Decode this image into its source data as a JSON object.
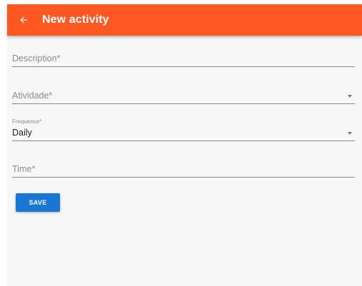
{
  "appbar": {
    "title": "New activity",
    "back_icon": "arrow-left-icon",
    "background": "#ff5722"
  },
  "form": {
    "description": {
      "placeholder": "Description*",
      "value": ""
    },
    "atividade": {
      "placeholder": "Atividade*",
      "value": "",
      "dropdown_icon": "caret-down-icon"
    },
    "frequence": {
      "label": "Frequence*",
      "value": "Daily",
      "dropdown_icon": "caret-down-icon"
    },
    "time": {
      "placeholder": "Time*",
      "value": ""
    },
    "save_label": "SAVE",
    "save_color": "#1976d2"
  }
}
